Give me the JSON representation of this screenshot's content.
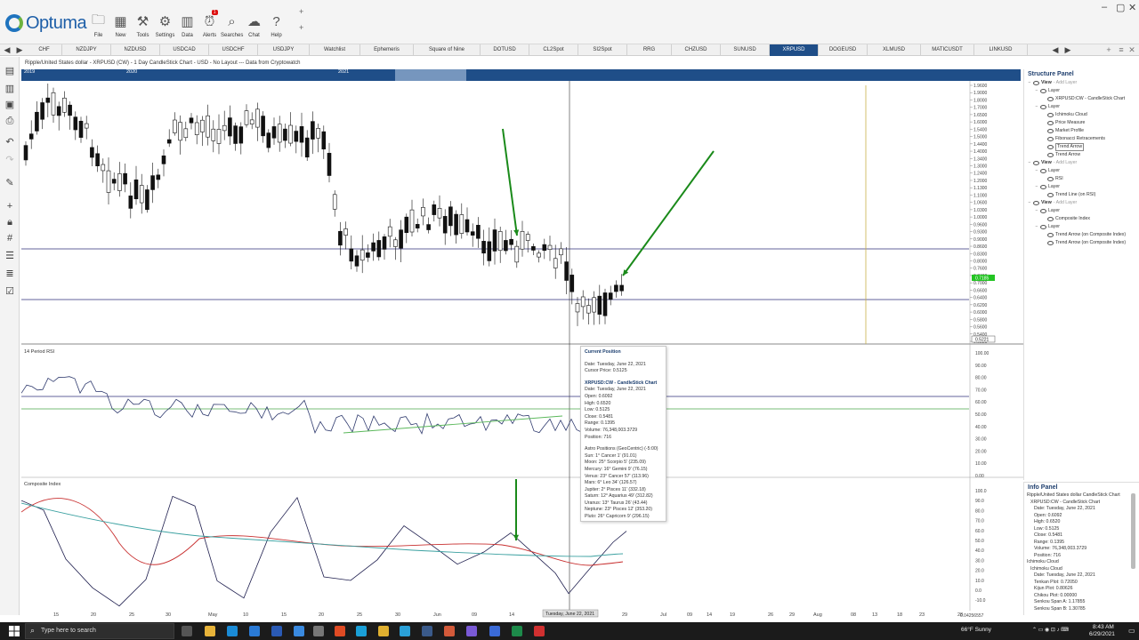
{
  "app": {
    "logo_text": "Optuma",
    "ribbon_buttons": [
      {
        "label": "File",
        "icon": "folder-icon"
      },
      {
        "label": "New",
        "icon": "new-chart-icon"
      },
      {
        "label": "Tools",
        "icon": "tools-icon"
      },
      {
        "label": "Settings",
        "icon": "gear-icon"
      },
      {
        "label": "Data",
        "icon": "data-grid-icon"
      },
      {
        "label": "Alerts",
        "icon": "alarm-clock-icon",
        "badge": "1"
      },
      {
        "label": "Searches",
        "icon": "search-icon"
      },
      {
        "label": "Chat",
        "icon": "chat-icon"
      },
      {
        "label": "Help",
        "icon": "help-icon"
      }
    ]
  },
  "tabs": {
    "items": [
      "CHF",
      "NZDJPY",
      "NZDUSD",
      "USDCAD",
      "USDCHF",
      "USDJPY",
      "Watchlist",
      "Ephemeris",
      "Square of Nine",
      "DOTUSD",
      "CL2Spot",
      "SI2Spot",
      "RRG",
      "CHZUSD",
      "SUNUSD",
      "XRPUSD",
      "DOGEUSD",
      "XLMUSD",
      "MATICUSDT",
      "LINKUSD"
    ],
    "active": "XRPUSD"
  },
  "chart": {
    "title": "Ripple/United States dollar - XRPUSD (CW) - 1 Day CandleStick Chart - USD - No Layout --- Data from Cryptowatch",
    "timeline_years": [
      "2019",
      "2020",
      "2021"
    ],
    "price_axis": [
      "1.9600",
      "1.9000",
      "1.8000",
      "1.7000",
      "1.6500",
      "1.6000",
      "1.5400",
      "1.5000",
      "1.4400",
      "1.4000",
      "1.3400",
      "1.3000",
      "1.2400",
      "1.2000",
      "1.1300",
      "1.1000",
      "1.0600",
      "1.0300",
      "1.0000",
      "0.9600",
      "0.9300",
      "0.9000",
      "0.8600",
      "0.8300",
      "0.8000",
      "0.7600",
      "0.7400",
      "0.7000",
      "0.6600",
      "0.6400",
      "0.6200",
      "0.6000",
      "0.5800",
      "0.5600",
      "0.5400",
      "0.5221"
    ],
    "last_price_label": "0.7185",
    "cursor_price_label": "0.5221",
    "rsi_title": "14 Period RSI",
    "rsi_axis": [
      "100.00",
      "90.00",
      "80.00",
      "70.00",
      "60.00",
      "50.00",
      "40.00",
      "30.00",
      "20.00",
      "10.00",
      "0.00"
    ],
    "ci_title": "Composite Index",
    "ci_axis": [
      "100.0",
      "90.0",
      "80.0",
      "70.0",
      "60.0",
      "50.0",
      "40.0",
      "30.0",
      "20.0",
      "10.0",
      "0.0",
      "-10.0"
    ],
    "date_axis": [
      "15",
      "20",
      "25",
      "30",
      "May",
      "10",
      "15",
      "20",
      "25",
      "30",
      "Jun",
      "09",
      "14",
      "29",
      "Jul",
      "09",
      "14",
      "19",
      "26",
      "29",
      "Aug",
      "08",
      "13",
      "18",
      "23",
      "28"
    ],
    "cursor_date_label": "Tuesday, June 22, 2021",
    "bottom_right_value": "0.04256557"
  },
  "tooltip": {
    "heading": "Current Position",
    "date": "Date: Tuesday, June 22, 2021",
    "cursor_price": "Cursor Price: 0.5125",
    "series_heading": "XRPUSD:CW - CandleStick Chart",
    "series_lines": [
      "Date: Tuesday, June 22, 2021",
      "Open: 0.6092",
      "High: 0.6520",
      "Low: 0.5125",
      "Close: 0.5481",
      "Range: 0.1395",
      "Volume: 76,348,003.3729",
      "Position: 716"
    ],
    "astro_heading": "Astro Positions (GeoCentric) (-5:00)",
    "astro_lines": [
      "Sun: 1° Cancer 1' (91.01)",
      "Moon: 25° Scorpio 5' (235.09)",
      "Mercury: 16° Gemini 9' (76.15)",
      "Venus: 23° Cancer 57' (113.96)",
      "Mars: 6° Leo 34' (126.57)",
      "Jupiter: 2° Pisces 11' (332.18)",
      "Saturn: 12° Aquarius 49' (312.82)",
      "Uranus: 13° Taurus 26' (43.44)",
      "Neptune: 23° Pisces 12' (353.20)",
      "Pluto: 26° Capricorn 9' (296.15)"
    ]
  },
  "structure_panel": {
    "title": "Structure Panel",
    "rows": [
      {
        "text": "View",
        "indent": 0,
        "add": "- Add Layer",
        "bold": true
      },
      {
        "text": "Layer",
        "indent": 1
      },
      {
        "text": "XRPUSD:CW - CandleStick Chart",
        "indent": 2
      },
      {
        "text": "Layer",
        "indent": 1
      },
      {
        "text": "Ichimoku Cloud",
        "indent": 2
      },
      {
        "text": "Price Measure",
        "indent": 2
      },
      {
        "text": "Market Profile",
        "indent": 2
      },
      {
        "text": "Fibonacci Retracements",
        "indent": 2
      },
      {
        "text": "Trend Arrow",
        "indent": 2,
        "selected": true
      },
      {
        "text": "Trend Arrow",
        "indent": 2
      },
      {
        "text": "View",
        "indent": 0,
        "add": "- Add Layer",
        "bold": true
      },
      {
        "text": "Layer",
        "indent": 1
      },
      {
        "text": "RSI",
        "indent": 2
      },
      {
        "text": "Layer",
        "indent": 1
      },
      {
        "text": "Trend Line (on RSI)",
        "indent": 2
      },
      {
        "text": "View",
        "indent": 0,
        "add": "- Add Layer",
        "bold": true
      },
      {
        "text": "Layer",
        "indent": 1
      },
      {
        "text": "Composite Index",
        "indent": 2
      },
      {
        "text": "Layer",
        "indent": 1
      },
      {
        "text": "Trend Arrow (on Composite Index)",
        "indent": 2
      },
      {
        "text": "Trend Arrow (on Composite Index)",
        "indent": 2
      }
    ]
  },
  "info_panel": {
    "title": "Info Panel",
    "lines": [
      "Ripple/United States dollar CandleStick Chart",
      " XRPUSD:CW - CandleStick Chart",
      "  Date: Tuesday, June 22, 2021",
      "  Open: 0.6092",
      "  High: 0.6520",
      "  Low: 0.5125",
      "  Close: 0.5481",
      "  Range: 0.1395",
      "  Volume: 76,348,003.3729",
      "  Position: 716",
      "Ichimoku Cloud",
      " Ichimoku Cloud",
      "  Date: Tuesday, June 22, 2021",
      "  Tenkan Plot: 0.72050",
      "  Kijun Plot: 0.80626",
      "  Chikou Plot: 0.00000",
      "  Senkou Span A: 1.17855",
      "  Senkou Span B: 1.30785"
    ]
  },
  "taskbar": {
    "search_placeholder": "Type here to search",
    "weather": "66°F  Sunny",
    "time": "8:43 AM",
    "date": "6/29/2021"
  },
  "colors": {
    "accent": "#1f4e88",
    "arrow": "#1a8a1a",
    "candle": "#111111"
  }
}
